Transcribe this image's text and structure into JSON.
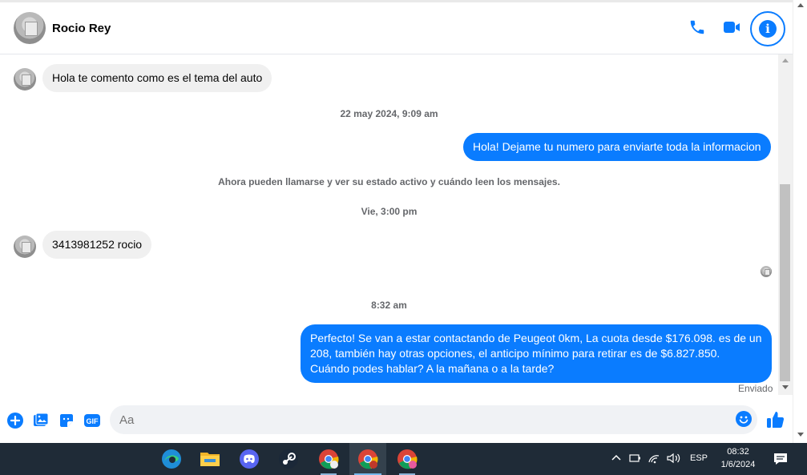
{
  "contact": {
    "name": "Rocio Rey"
  },
  "messages": {
    "m1": "Hola te comento como es el tema del auto",
    "stamp1": "22 may 2024, 9:09 am",
    "m2": "Hola! Dejame tu numero para enviarte toda la informacion",
    "notice": "Ahora pueden llamarse y ver su estado activo y cuándo leen los mensajes.",
    "stamp2": "Vie, 3:00 pm",
    "m3": "3413981252 rocio",
    "stamp3": "8:32 am",
    "m4": "Perfecto!  Se van a estar contactando de Peugeot 0km, La cuota desde $176.098. es de un 208, también hay otras opciones, el anticipo mínimo para retirar es de $6.827.850. Cuándo podes hablar? A la mañana o a la tarde?",
    "status": "Enviado"
  },
  "composer": {
    "placeholder": "Aa",
    "gif_label": "GIF"
  },
  "taskbar": {
    "language": "ESP",
    "time": "08:32",
    "date": "1/6/2024"
  },
  "colors": {
    "accent": "#0a7cff",
    "incoming_bubble": "#f0f0f0",
    "taskbar": "#1f2b37"
  }
}
